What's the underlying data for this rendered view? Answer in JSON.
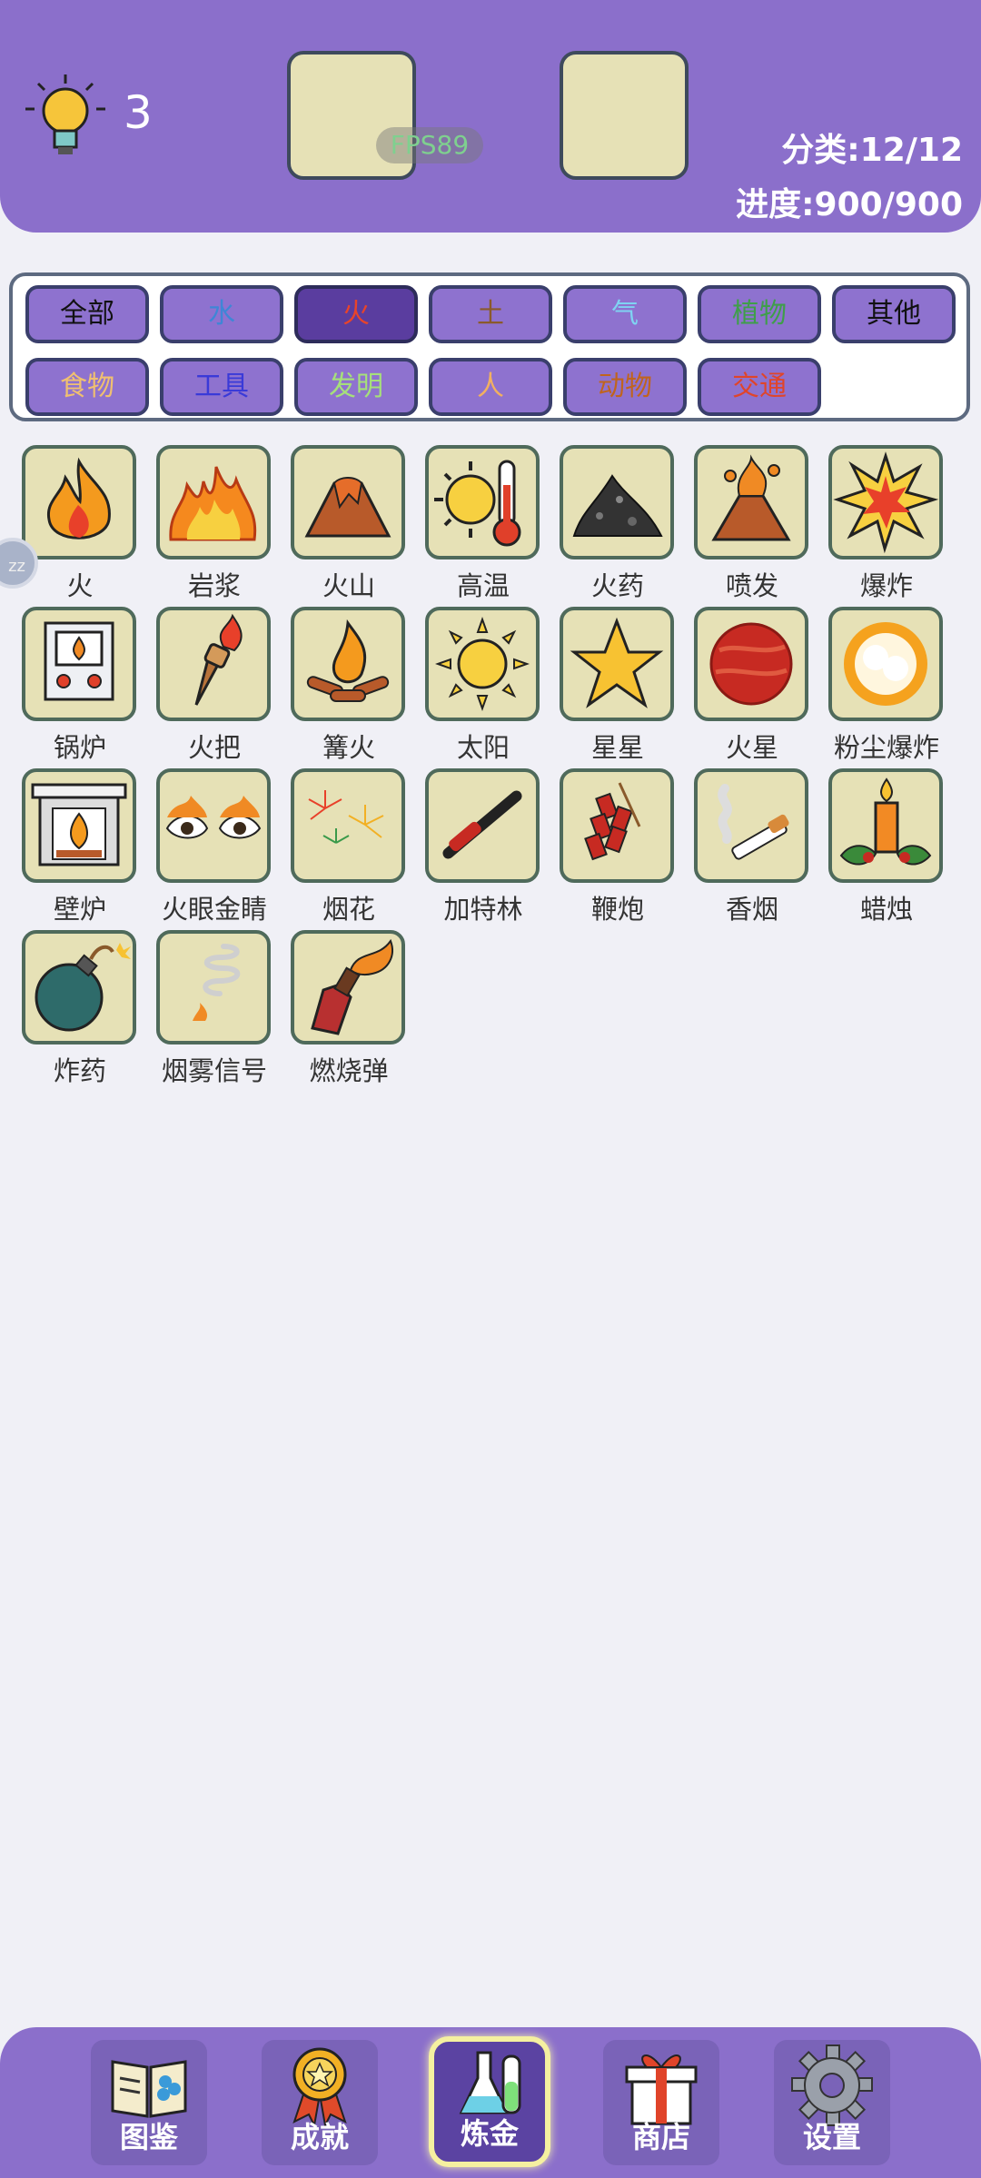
{
  "header": {
    "hint_count": "3",
    "fps": "FPS89",
    "category": "分类:12/12",
    "progress": "进度:900/900"
  },
  "tabs": [
    {
      "label": "全部",
      "color": "#111111",
      "active": false
    },
    {
      "label": "水",
      "color": "#3f86d6",
      "active": false
    },
    {
      "label": "火",
      "color": "#e8442a",
      "active": true
    },
    {
      "label": "土",
      "color": "#8a5a2b",
      "active": false
    },
    {
      "label": "气",
      "color": "#7fd3f2",
      "active": false
    },
    {
      "label": "植物",
      "color": "#3f9e4a",
      "active": false
    },
    {
      "label": "其他",
      "color": "#111111",
      "active": false
    },
    {
      "label": "食物",
      "color": "#f0c070",
      "active": false
    },
    {
      "label": "工具",
      "color": "#3a3ad8",
      "active": false
    },
    {
      "label": "发明",
      "color": "#a6e07a",
      "active": false
    },
    {
      "label": "人",
      "color": "#f2b060",
      "active": false
    },
    {
      "label": "动物",
      "color": "#c0641e",
      "active": false
    },
    {
      "label": "交通",
      "color": "#e0452a",
      "active": false
    }
  ],
  "items": [
    {
      "label": "火",
      "icon": "flame-icon"
    },
    {
      "label": "岩浆",
      "icon": "lava-icon"
    },
    {
      "label": "火山",
      "icon": "volcano-icon"
    },
    {
      "label": "高温",
      "icon": "sun-thermometer-icon"
    },
    {
      "label": "火药",
      "icon": "gunpowder-icon"
    },
    {
      "label": "喷发",
      "icon": "eruption-icon"
    },
    {
      "label": "爆炸",
      "icon": "explosion-icon"
    },
    {
      "label": "锅炉",
      "icon": "boiler-icon"
    },
    {
      "label": "火把",
      "icon": "torch-icon"
    },
    {
      "label": "篝火",
      "icon": "bonfire-icon"
    },
    {
      "label": "太阳",
      "icon": "sun-icon"
    },
    {
      "label": "星星",
      "icon": "star-icon"
    },
    {
      "label": "火星",
      "icon": "mars-icon"
    },
    {
      "label": "粉尘爆炸",
      "icon": "dust-explosion-icon"
    },
    {
      "label": "壁炉",
      "icon": "fireplace-icon"
    },
    {
      "label": "火眼金睛",
      "icon": "fire-eyes-icon"
    },
    {
      "label": "烟花",
      "icon": "fireworks-icon"
    },
    {
      "label": "加特林",
      "icon": "gatling-icon"
    },
    {
      "label": "鞭炮",
      "icon": "firecracker-icon"
    },
    {
      "label": "香烟",
      "icon": "cigarette-icon"
    },
    {
      "label": "蜡烛",
      "icon": "candle-icon"
    },
    {
      "label": "炸药",
      "icon": "bomb-icon"
    },
    {
      "label": "烟雾信号",
      "icon": "smoke-signal-icon"
    },
    {
      "label": "燃烧弹",
      "icon": "molotov-icon"
    }
  ],
  "side_bubble": "zz",
  "nav": [
    {
      "label": "图鉴",
      "icon": "book-icon",
      "active": false
    },
    {
      "label": "成就",
      "icon": "medal-icon",
      "active": false
    },
    {
      "label": "炼金",
      "icon": "flask-icon",
      "active": true
    },
    {
      "label": "商店",
      "icon": "gift-icon",
      "active": false
    },
    {
      "label": "设置",
      "icon": "gear-icon",
      "active": false
    }
  ]
}
